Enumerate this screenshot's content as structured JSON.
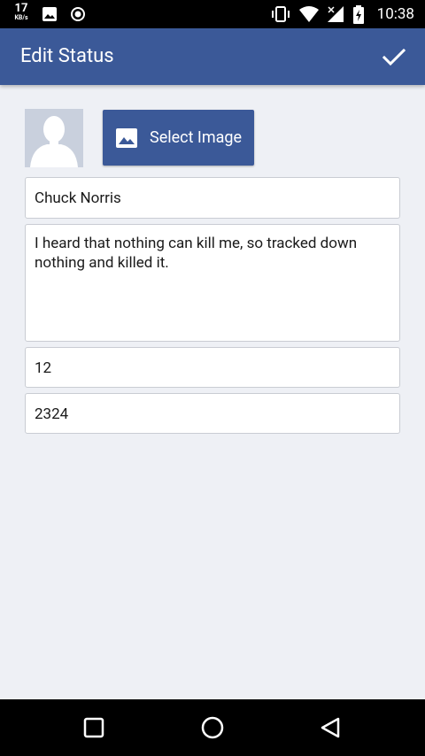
{
  "status_bar": {
    "speed_value": "17",
    "speed_unit": "KB/s",
    "time": "10:38"
  },
  "app_bar": {
    "title": "Edit Status",
    "confirm_icon": "check-icon"
  },
  "form": {
    "select_image_label": "Select Image",
    "name_value": "Chuck Norris",
    "status_value": "I heard that nothing can kill me, so tracked down nothing and killed it.",
    "number_field_1": "12",
    "number_field_2": "2324"
  },
  "nav": {
    "icons": [
      "square-icon",
      "circle-icon",
      "triangle-back-icon"
    ]
  },
  "colors": {
    "primary": "#3b5998",
    "background": "#eef0f5",
    "status_bar": "#000000"
  }
}
